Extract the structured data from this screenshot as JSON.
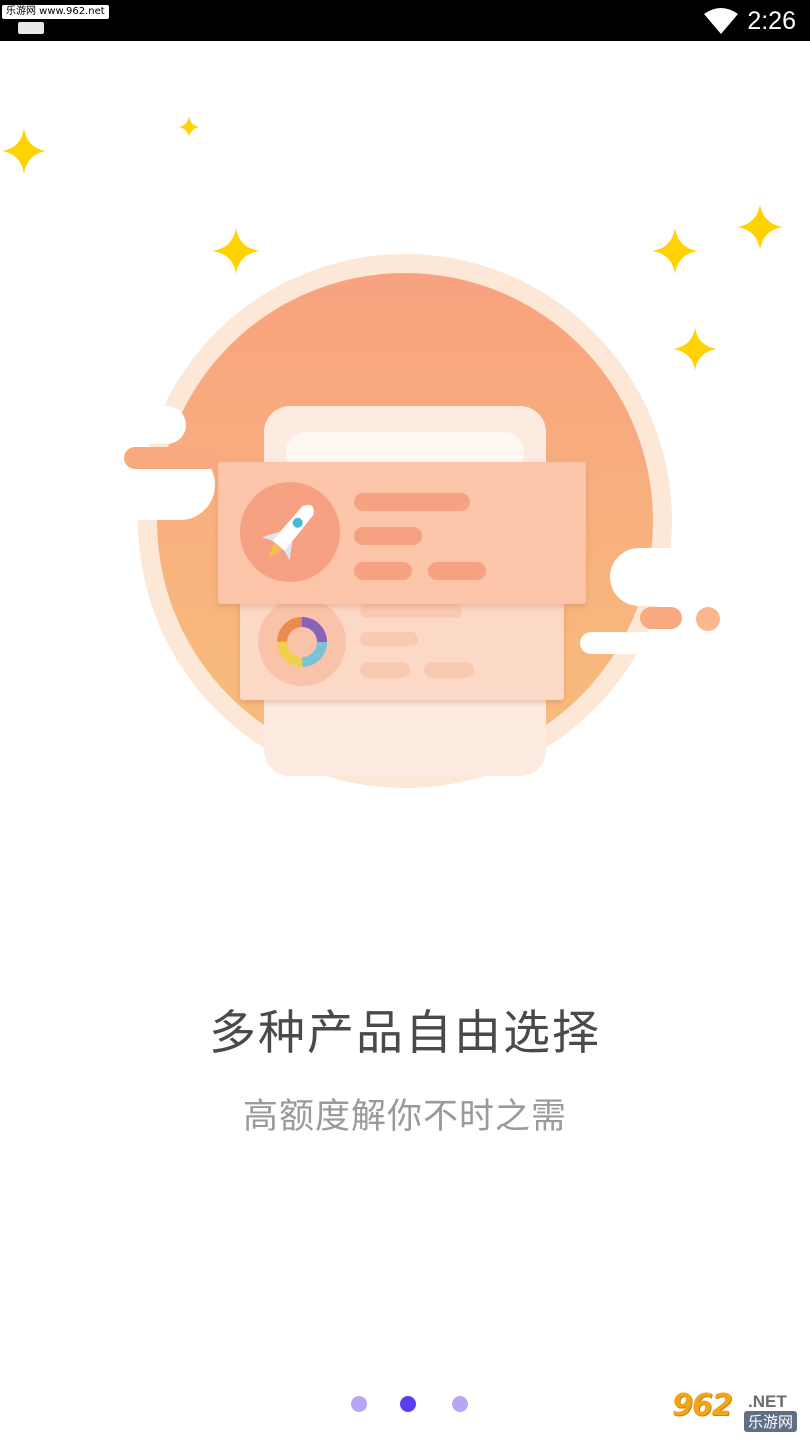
{
  "status_bar": {
    "watermark": "乐游网 www.962.net",
    "time": "2:26",
    "icons": [
      "wifi-icon"
    ]
  },
  "illustration": {
    "icons": [
      "rocket-icon",
      "ring-chart-icon",
      "star-icon"
    ],
    "colors": {
      "circle_top": "#f8a77f",
      "circle_bottom": "#f8b97c",
      "circle_ring": "#fde6d3",
      "card": "#fbc2a5",
      "card_bar": "#f6a07d",
      "star": "#ffd200"
    }
  },
  "onboarding": {
    "title": "多种产品自由选择",
    "subtitle": "高额度解你不时之需",
    "page_count": 3,
    "current_page": 2
  },
  "colors": {
    "title": "#4a4a4a",
    "subtitle": "#9a9a9a",
    "dot_active": "#5b3ef0",
    "dot_inactive": "#b8a6f5"
  },
  "watermark": {
    "logo": "962",
    "net": ".NET",
    "cn": "乐游网"
  }
}
